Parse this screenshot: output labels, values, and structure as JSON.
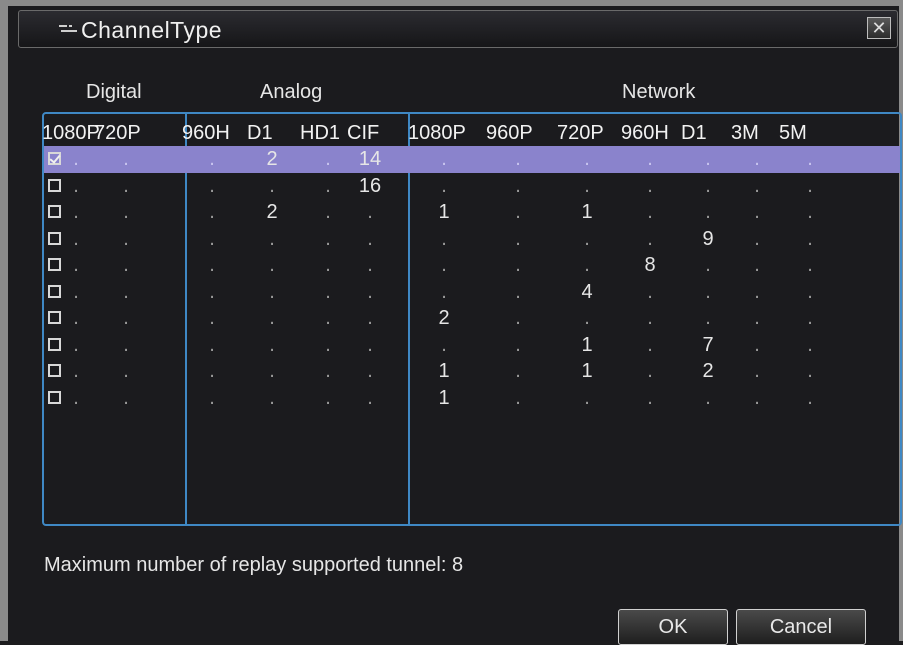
{
  "window": {
    "title": "ChannelType",
    "close_label": "✕"
  },
  "groups": [
    "Digital",
    "Analog",
    "Network"
  ],
  "columns": [
    "1080P",
    "720P",
    "960H",
    "D1",
    "HD1",
    "CIF",
    "1080P",
    "960P",
    "720P",
    "960H",
    "D1",
    "3M",
    "5M"
  ],
  "rows": [
    {
      "checked": true,
      "selected": true,
      "values": [
        "",
        "",
        "",
        "2",
        "",
        "14",
        "",
        "",
        "",
        "",
        "",
        "",
        ""
      ]
    },
    {
      "checked": false,
      "selected": false,
      "values": [
        "",
        "",
        "",
        "",
        "",
        "16",
        "",
        "",
        "",
        "",
        "",
        "",
        ""
      ]
    },
    {
      "checked": false,
      "selected": false,
      "values": [
        "",
        "",
        "",
        "2",
        "",
        "",
        "1",
        "",
        "1",
        "",
        "",
        "",
        ""
      ]
    },
    {
      "checked": false,
      "selected": false,
      "values": [
        "",
        "",
        "",
        "",
        "",
        "",
        "",
        "",
        "",
        "",
        "9",
        "",
        ""
      ]
    },
    {
      "checked": false,
      "selected": false,
      "values": [
        "",
        "",
        "",
        "",
        "",
        "",
        "",
        "",
        "",
        "8",
        "",
        "",
        ""
      ]
    },
    {
      "checked": false,
      "selected": false,
      "values": [
        "",
        "",
        "",
        "",
        "",
        "",
        "",
        "",
        "4",
        "",
        "",
        "",
        ""
      ]
    },
    {
      "checked": false,
      "selected": false,
      "values": [
        "",
        "",
        "",
        "",
        "",
        "",
        "2",
        "",
        "",
        "",
        "",
        "",
        ""
      ]
    },
    {
      "checked": false,
      "selected": false,
      "values": [
        "",
        "",
        "",
        "",
        "",
        "",
        "",
        "",
        "1",
        "",
        "7",
        "",
        ""
      ]
    },
    {
      "checked": false,
      "selected": false,
      "values": [
        "",
        "",
        "",
        "",
        "",
        "",
        "1",
        "",
        "1",
        "",
        "2",
        "",
        ""
      ]
    },
    {
      "checked": false,
      "selected": false,
      "values": [
        "",
        "",
        "",
        "",
        "",
        "",
        "1",
        "",
        "",
        "",
        "",
        "",
        ""
      ]
    }
  ],
  "empty_marker": ".",
  "info_text": "Maximum number of replay supported tunnel: 8",
  "buttons": {
    "ok": "OK",
    "cancel": "Cancel"
  },
  "colors": {
    "selection": "#8a83cc",
    "grid_border": "#3f88c4"
  }
}
